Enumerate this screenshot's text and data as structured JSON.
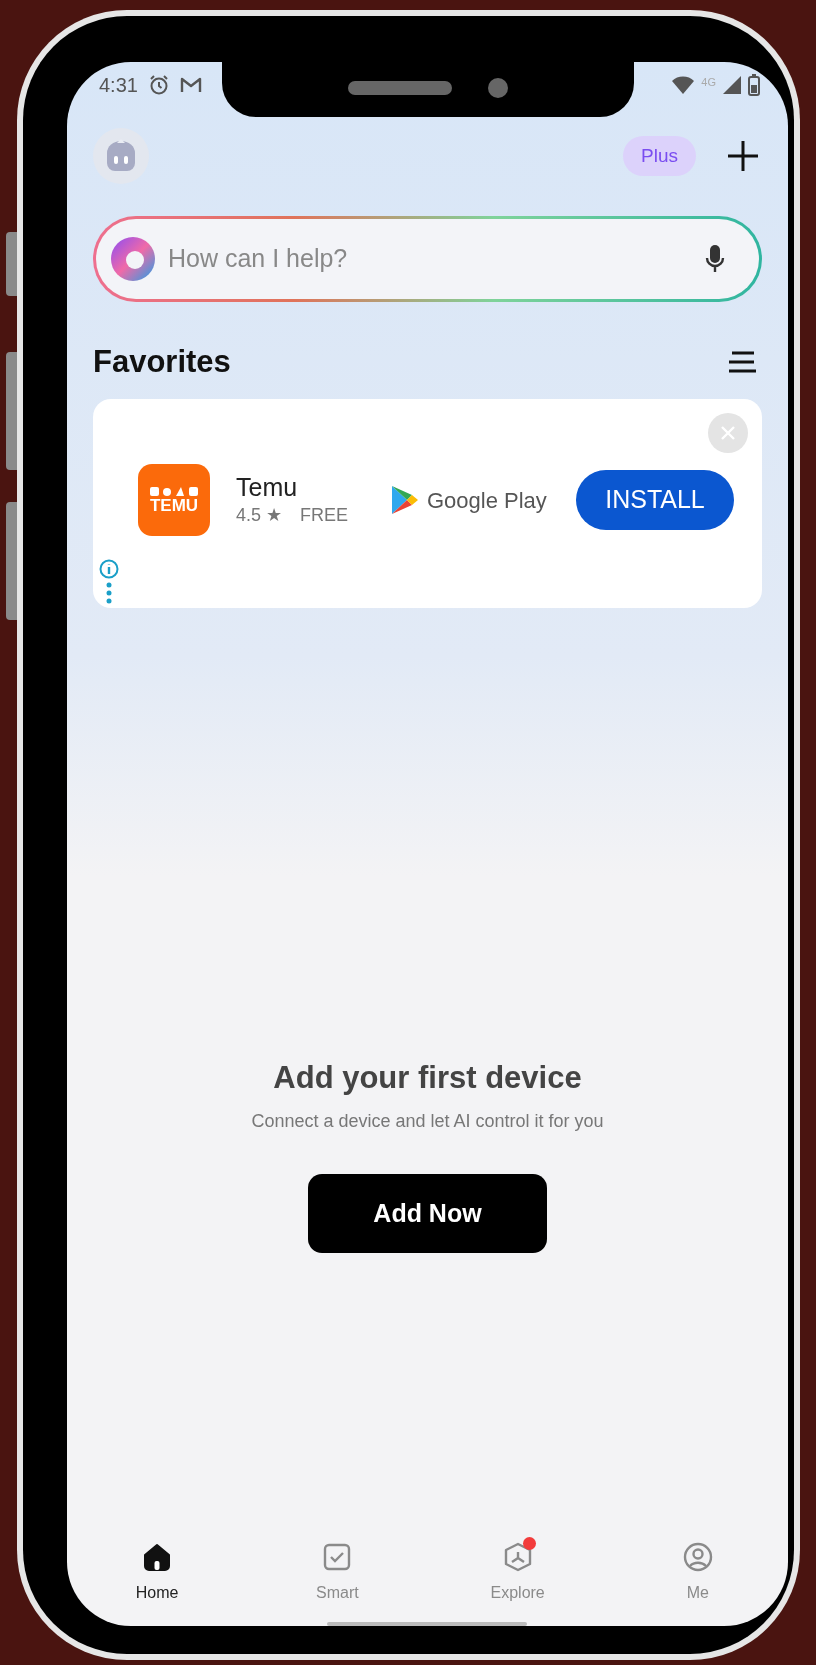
{
  "status_bar": {
    "time": "4:31",
    "network": "4G"
  },
  "header": {
    "plan_badge": "Plus"
  },
  "search": {
    "placeholder": "How can I help?"
  },
  "favorites": {
    "title": "Favorites"
  },
  "ad": {
    "app_icon_text": "TEMU",
    "app_name": "Temu",
    "rating": "4.5 ★",
    "price": "FREE",
    "store": "Google Play",
    "button": "INSTALL"
  },
  "empty_state": {
    "title": "Add your first device",
    "subtitle": "Connect a device and let AI control it for you",
    "button": "Add Now"
  },
  "nav": [
    {
      "kind": "home",
      "label": "Home",
      "selected": true,
      "notification": false
    },
    {
      "kind": "smart",
      "label": "Smart",
      "selected": false,
      "notification": false
    },
    {
      "kind": "explore",
      "label": "Explore",
      "selected": false,
      "notification": true
    },
    {
      "kind": "me",
      "label": "Me",
      "selected": false,
      "notification": false
    }
  ]
}
